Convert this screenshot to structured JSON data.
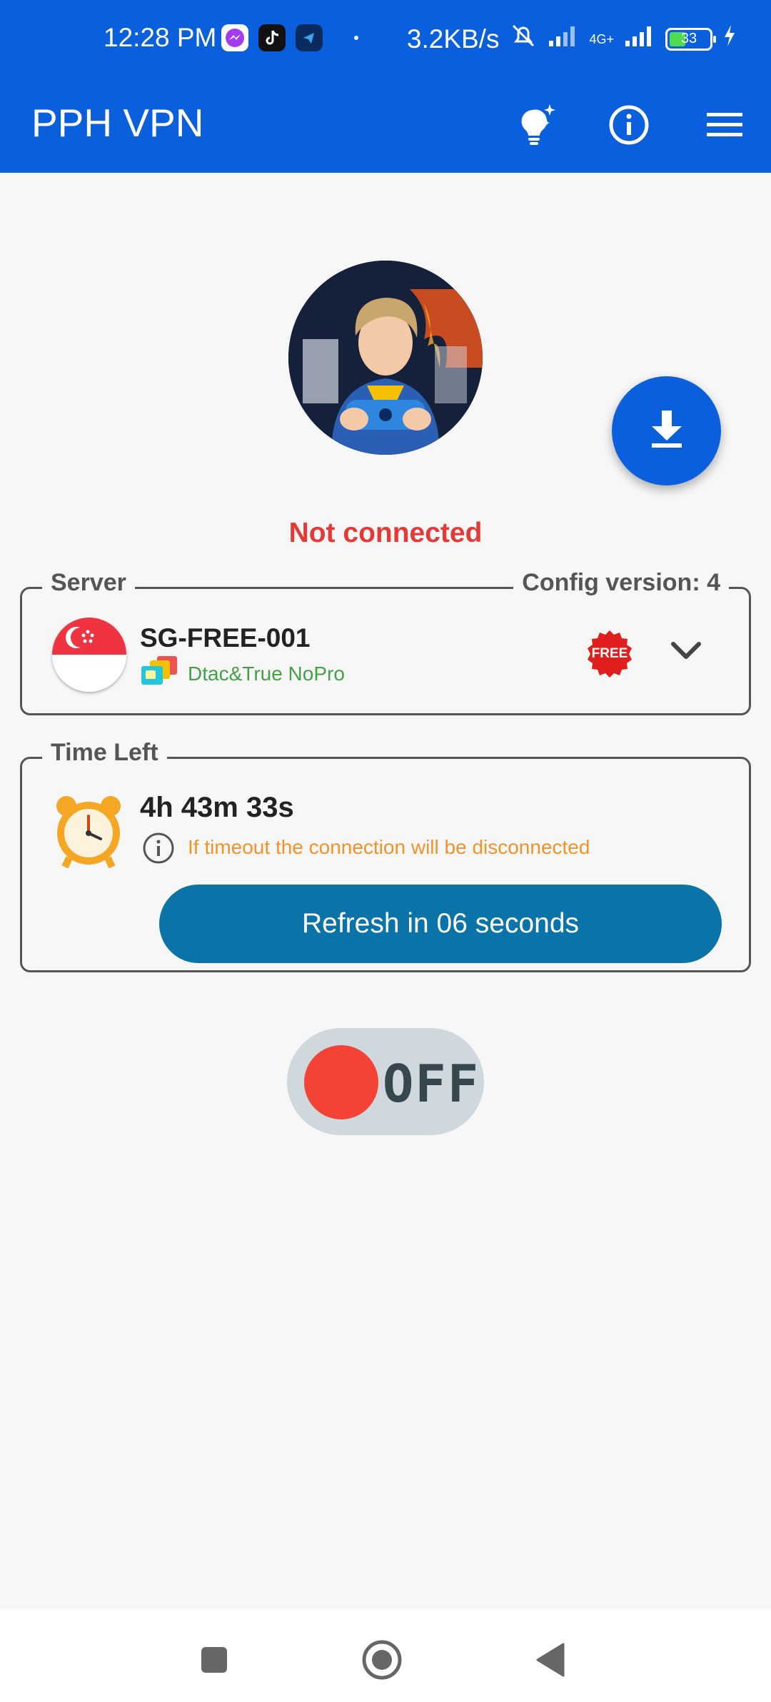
{
  "status_bar": {
    "time": "12:28 PM",
    "net_speed": "3.2KB/s",
    "network_type": "4G+",
    "battery_level": "33"
  },
  "app_bar": {
    "title": "PPH VPN"
  },
  "connection": {
    "status_text": "Not connected",
    "status_color": "#e53935"
  },
  "server": {
    "legend": "Server",
    "config_version": "Config version: 4",
    "name": "SG-FREE-001",
    "sub_label": "Dtac&True NoPro",
    "badge_text": "FREE"
  },
  "time_left": {
    "legend": "Time Left",
    "value": "4h 43m 33s",
    "note": "If timeout the connection will be disconnected",
    "refresh_label": "Refresh in 06 seconds"
  },
  "toggle": {
    "label": "OFF",
    "state": "off"
  },
  "colors": {
    "primary": "#0a5fdc",
    "refresh": "#0a73a8",
    "off_knob": "#f44336",
    "sub_green": "#43a047",
    "note_orange": "#f0932b"
  }
}
